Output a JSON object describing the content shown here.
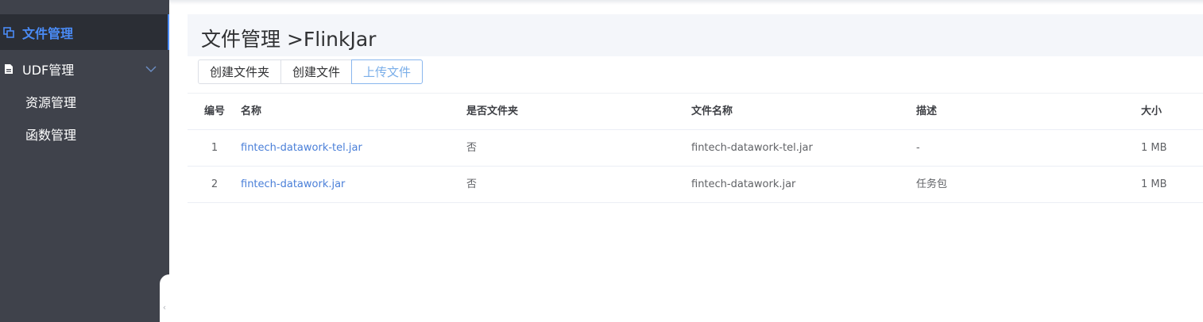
{
  "sidebar": {
    "items": [
      {
        "label": "文件管理",
        "icon": "files-icon",
        "active": true
      },
      {
        "label": "UDF管理",
        "icon": "document-icon",
        "expanded": true,
        "children": [
          {
            "label": "资源管理"
          },
          {
            "label": "函数管理"
          }
        ]
      }
    ],
    "collapse_glyph": "‹"
  },
  "main": {
    "title": "文件管理 >FlinkJar",
    "toolbar": {
      "create_folder": "创建文件夹",
      "create_file": "创建文件",
      "upload_file": "上传文件"
    },
    "table": {
      "columns": [
        "编号",
        "名称",
        "是否文件夹",
        "文件名称",
        "描述",
        "大小"
      ],
      "rows": [
        {
          "no": "1",
          "name": "fintech-datawork-tel.jar",
          "is_dir": "否",
          "file_name": "fintech-datawork-tel.jar",
          "desc": "-",
          "size": "1 MB"
        },
        {
          "no": "2",
          "name": "fintech-datawork.jar",
          "is_dir": "否",
          "file_name": "fintech-datawork.jar",
          "desc": "任务包",
          "size": "1 MB"
        }
      ]
    }
  },
  "colors": {
    "sidebar_bg": "#3f424b",
    "sidebar_active_bg": "#2b2e35",
    "accent": "#4a8bf5",
    "link": "#4a7fd8"
  }
}
